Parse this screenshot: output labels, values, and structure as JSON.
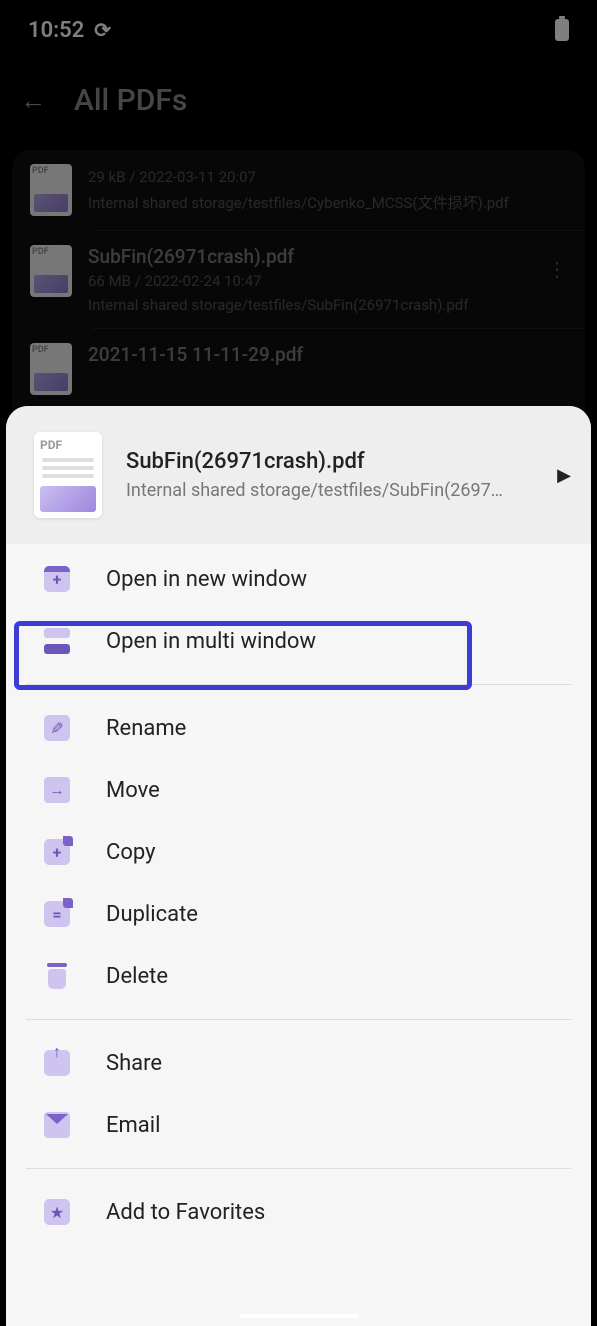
{
  "status": {
    "time": "10:52"
  },
  "header": {
    "title": "All PDFs"
  },
  "list": {
    "items": [
      {
        "name": "",
        "meta": "29 kB / 2022-03-11 20:07",
        "path": "Internal shared storage/testfiles/Cybenko_MCSS(文件损坏).pdf"
      },
      {
        "name": "SubFin(26971crash).pdf",
        "meta": "66 MB / 2022-02-24 10:47",
        "path": "Internal shared storage/testfiles/SubFin(26971crash).pdf"
      },
      {
        "name": "2021-11-15 11-11-29.pdf",
        "meta": "",
        "path": ""
      }
    ]
  },
  "sheet": {
    "file_name": "SubFin(26971crash).pdf",
    "file_path": "Internal shared storage/testfiles/SubFin(2697…",
    "options": {
      "open_new_window": "Open in new window",
      "open_multi_window": "Open in multi window",
      "rename": "Rename",
      "move": "Move",
      "copy": "Copy",
      "duplicate": "Duplicate",
      "delete": "Delete",
      "share": "Share",
      "email": "Email",
      "add_favorites": "Add to Favorites"
    }
  }
}
